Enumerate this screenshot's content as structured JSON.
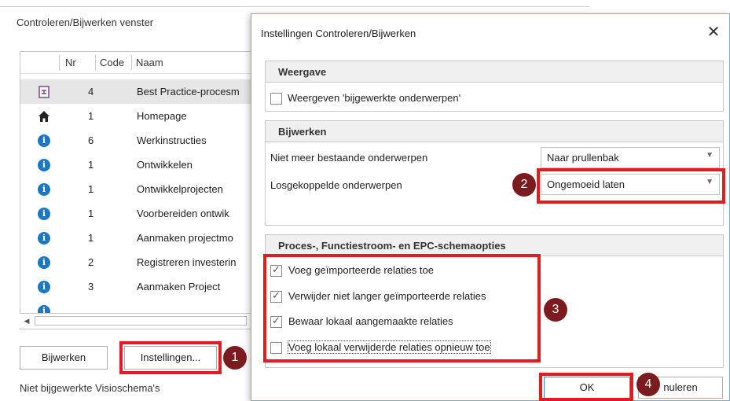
{
  "background_window": {
    "title": "Controleren/Bijwerken venster",
    "columns": [
      "Nr",
      "Code",
      "Naam"
    ],
    "rows": [
      {
        "icon": "process-shape-icon",
        "nr": "4",
        "naam": "Best Practice-procesm"
      },
      {
        "icon": "home-icon",
        "nr": "1",
        "naam": "Homepage"
      },
      {
        "icon": "info-icon",
        "nr": "6",
        "naam": "Werkinstructies"
      },
      {
        "icon": "info-icon",
        "nr": "1",
        "naam": "Ontwikkelen"
      },
      {
        "icon": "info-icon",
        "nr": "1",
        "naam": "Ontwikkelprojecten"
      },
      {
        "icon": "info-icon",
        "nr": "1",
        "naam": "Voorbereiden ontwik"
      },
      {
        "icon": "info-icon",
        "nr": "1",
        "naam": "Aanmaken projectmo"
      },
      {
        "icon": "info-icon",
        "nr": "2",
        "naam": "Registreren investerin"
      },
      {
        "icon": "info-icon",
        "nr": "3",
        "naam": "Aanmaken Project"
      }
    ],
    "buttons": {
      "bijwerken": "Bijwerken",
      "instellingen": "Instellingen..."
    },
    "status": "Niet bijgewerkte Visioschema's"
  },
  "dialog": {
    "title": "Instellingen Controleren/Bijwerken",
    "close_glyph": "✕",
    "weergave": {
      "header": "Weergave",
      "checkbox_label": "Weergeven 'bijgewerkte onderwerpen'",
      "checked": false
    },
    "bijwerken": {
      "header": "Bijwerken",
      "row1_label": "Niet meer bestaande onderwerpen",
      "row1_value": "Naar prullenbak",
      "row2_label": "Losgekoppelde onderwerpen",
      "row2_value": "Ongemoeid laten"
    },
    "proces": {
      "header": "Proces-, Functiestroom- en EPC-schemaopties",
      "options": [
        {
          "label": "Voeg geïmporteerde relaties toe",
          "checked": true
        },
        {
          "label": "Verwijder niet langer geïmporteerde relaties",
          "checked": true
        },
        {
          "label": "Bewaar lokaal aangemaakte relaties",
          "checked": true
        },
        {
          "label": "Voeg lokaal verwijderde relaties opnieuw toe",
          "checked": false
        }
      ]
    },
    "buttons": {
      "ok": "OK",
      "annuleren": "nuleren"
    }
  },
  "annotations": {
    "b1": "1",
    "b2": "2",
    "b3": "3",
    "b4": "4",
    "color": "#e01b24",
    "bubble_color": "#7c1b1f"
  },
  "colors": {
    "info": "#1a78c2",
    "selected_row": "#e6e6e6"
  }
}
